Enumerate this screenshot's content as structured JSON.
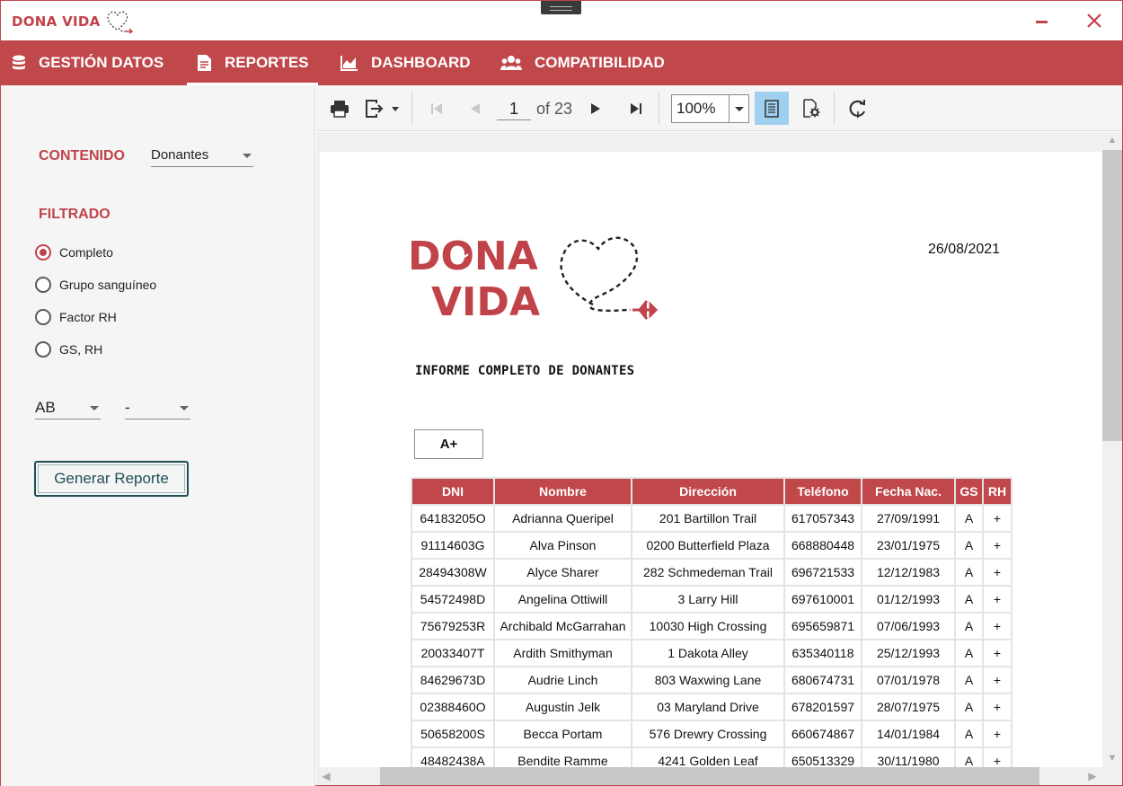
{
  "app": {
    "title": "DONA VIDA"
  },
  "nav": {
    "tabs": [
      {
        "label": "GESTIÓN DATOS",
        "icon": "database-icon"
      },
      {
        "label": "REPORTES",
        "icon": "report-icon"
      },
      {
        "label": "DASHBOARD",
        "icon": "area-chart-icon"
      },
      {
        "label": "COMPATIBILIDAD",
        "icon": "users-icon"
      }
    ],
    "active": "REPORTES"
  },
  "sidebar": {
    "contenido_label": "CONTENIDO",
    "contenido_value": "Donantes",
    "filtrado_label": "FILTRADO",
    "filters": [
      {
        "label": "Completo",
        "checked": true
      },
      {
        "label": "Grupo sanguíneo",
        "checked": false
      },
      {
        "label": "Factor RH",
        "checked": false
      },
      {
        "label": "GS, RH",
        "checked": false
      }
    ],
    "blood_group_value": "AB",
    "rh_value": "-",
    "generate_label": "Generar Reporte"
  },
  "toolbar": {
    "page": "1",
    "of_label": "of 23",
    "zoom": "100%"
  },
  "report": {
    "logo_line1": "DONA",
    "logo_line2": "VIDA",
    "date": "26/08/2021",
    "title": "INFORME COMPLETO DE DONANTES",
    "group": "A+",
    "columns": [
      "DNI",
      "Nombre",
      "Dirección",
      "Teléfono",
      "Fecha Nac.",
      "GS",
      "RH"
    ],
    "rows": [
      [
        "64183205O",
        "Adrianna Queripel",
        "201 Bartillon Trail",
        "617057343",
        "27/09/1991",
        "A",
        "+"
      ],
      [
        "91114603G",
        "Alva Pinson",
        "0200 Butterfield Plaza",
        "668880448",
        "23/01/1975",
        "A",
        "+"
      ],
      [
        "28494308W",
        "Alyce Sharer",
        "282 Schmedeman Trail",
        "696721533",
        "12/12/1983",
        "A",
        "+"
      ],
      [
        "54572498D",
        "Angelina Ottiwill",
        "3 Larry Hill",
        "697610001",
        "01/12/1993",
        "A",
        "+"
      ],
      [
        "75679253R",
        "Archibald McGarrahan",
        "10030 High Crossing",
        "695659871",
        "07/06/1993",
        "A",
        "+"
      ],
      [
        "20033407T",
        "Ardith Smithyman",
        "1 Dakota Alley",
        "635340118",
        "25/12/1993",
        "A",
        "+"
      ],
      [
        "84629673D",
        "Audrie Linch",
        "803 Waxwing Lane",
        "680674731",
        "07/01/1978",
        "A",
        "+"
      ],
      [
        "02388460O",
        "Augustin Jelk",
        "03 Maryland Drive",
        "678201597",
        "28/07/1975",
        "A",
        "+"
      ],
      [
        "50658200S",
        "Becca Portam",
        "576 Drewry Crossing",
        "660674867",
        "14/01/1984",
        "A",
        "+"
      ],
      [
        "48482438A",
        "Bendite Ramme",
        "4241 Golden Leaf",
        "650513329",
        "30/11/1980",
        "A",
        "+"
      ]
    ]
  },
  "colors": {
    "accent": "#c0474a",
    "button_text": "#1f4f55",
    "toolbar_active": "#9fd0f0"
  }
}
